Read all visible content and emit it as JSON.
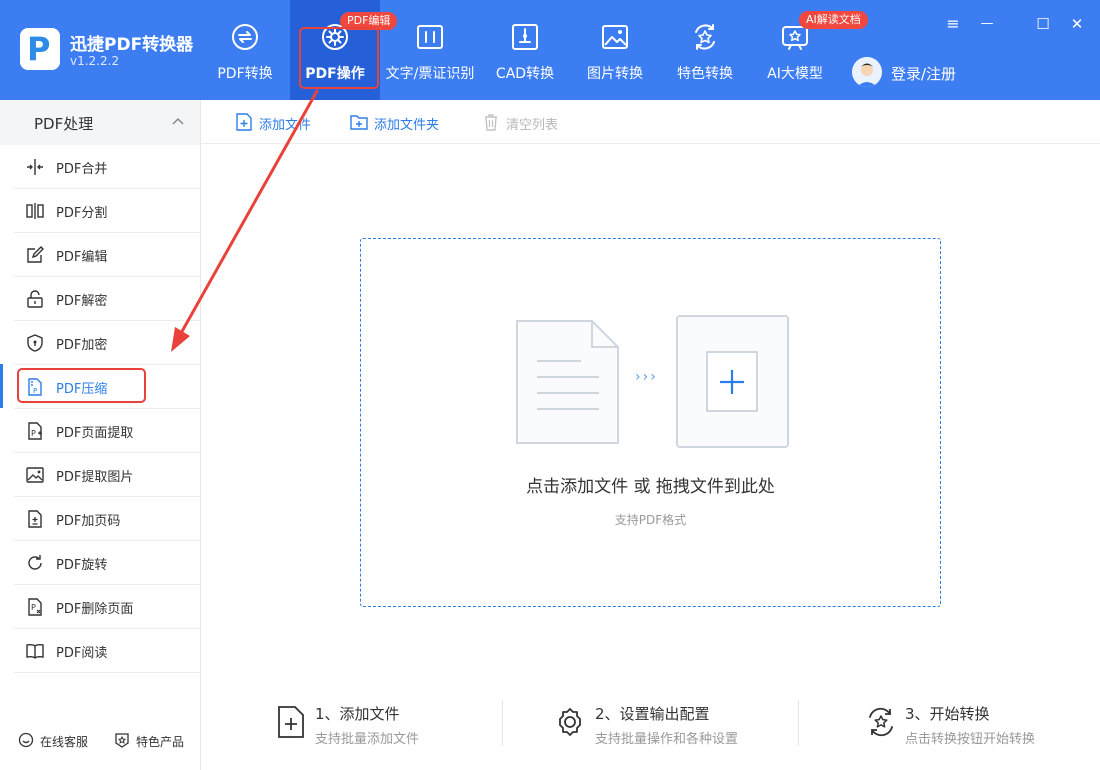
{
  "app": {
    "title": "迅捷PDF转换器",
    "version": "v1.2.2.2",
    "logo_letter": "P"
  },
  "nav": {
    "items": [
      {
        "label": "PDF转换",
        "icon": "pdf-convert-icon"
      },
      {
        "label": "PDF操作",
        "icon": "pdf-operate-icon",
        "active": true
      },
      {
        "label": "文字/票证识别",
        "icon": "ocr-icon"
      },
      {
        "label": "CAD转换",
        "icon": "cad-icon"
      },
      {
        "label": "图片转换",
        "icon": "image-icon"
      },
      {
        "label": "特色转换",
        "icon": "special-icon"
      },
      {
        "label": "AI大模型",
        "icon": "ai-icon"
      }
    ],
    "badge_pdf_edit": "PDF编辑",
    "badge_ai_read": "AI解读文档"
  },
  "user": {
    "login_label": "登录/注册"
  },
  "window_controls": {
    "menu": "≡",
    "minimize": "—",
    "maximize": "☐",
    "close": "✕"
  },
  "sidebar": {
    "section_title": "PDF处理",
    "items": [
      {
        "label": "PDF合并",
        "icon": "merge-icon"
      },
      {
        "label": "PDF分割",
        "icon": "split-icon"
      },
      {
        "label": "PDF编辑",
        "icon": "edit-icon"
      },
      {
        "label": "PDF解密",
        "icon": "unlock-icon"
      },
      {
        "label": "PDF加密",
        "icon": "shield-icon"
      },
      {
        "label": "PDF压缩",
        "icon": "compress-icon",
        "active": true
      },
      {
        "label": "PDF页面提取",
        "icon": "page-extract-icon"
      },
      {
        "label": "PDF提取图片",
        "icon": "image-extract-icon"
      },
      {
        "label": "PDF加页码",
        "icon": "page-number-icon"
      },
      {
        "label": "PDF旋转",
        "icon": "rotate-icon"
      },
      {
        "label": "PDF删除页面",
        "icon": "delete-page-icon"
      },
      {
        "label": "PDF阅读",
        "icon": "book-icon"
      }
    ],
    "footer": {
      "service": "在线客服",
      "products": "特色产品"
    }
  },
  "toolbar": {
    "add_file": "添加文件",
    "add_folder": "添加文件夹",
    "clear_list": "清空列表"
  },
  "dropzone": {
    "main_text": "点击添加文件 或 拖拽文件到此处",
    "sub_text": "支持PDF格式",
    "chevrons": "›››"
  },
  "steps": [
    {
      "title": "1、添加文件",
      "desc": "支持批量添加文件",
      "icon": "add-file-icon"
    },
    {
      "title": "2、设置输出配置",
      "desc": "支持批量操作和各种设置",
      "icon": "gear-icon"
    },
    {
      "title": "3、开始转换",
      "desc": "点击转换按钮开始转换",
      "icon": "convert-icon"
    }
  ],
  "colors": {
    "header_blue": "#3d7df2",
    "active_tab_blue": "#2560d8",
    "accent_blue": "#2b7de9",
    "annotation_red": "#e8423a"
  }
}
